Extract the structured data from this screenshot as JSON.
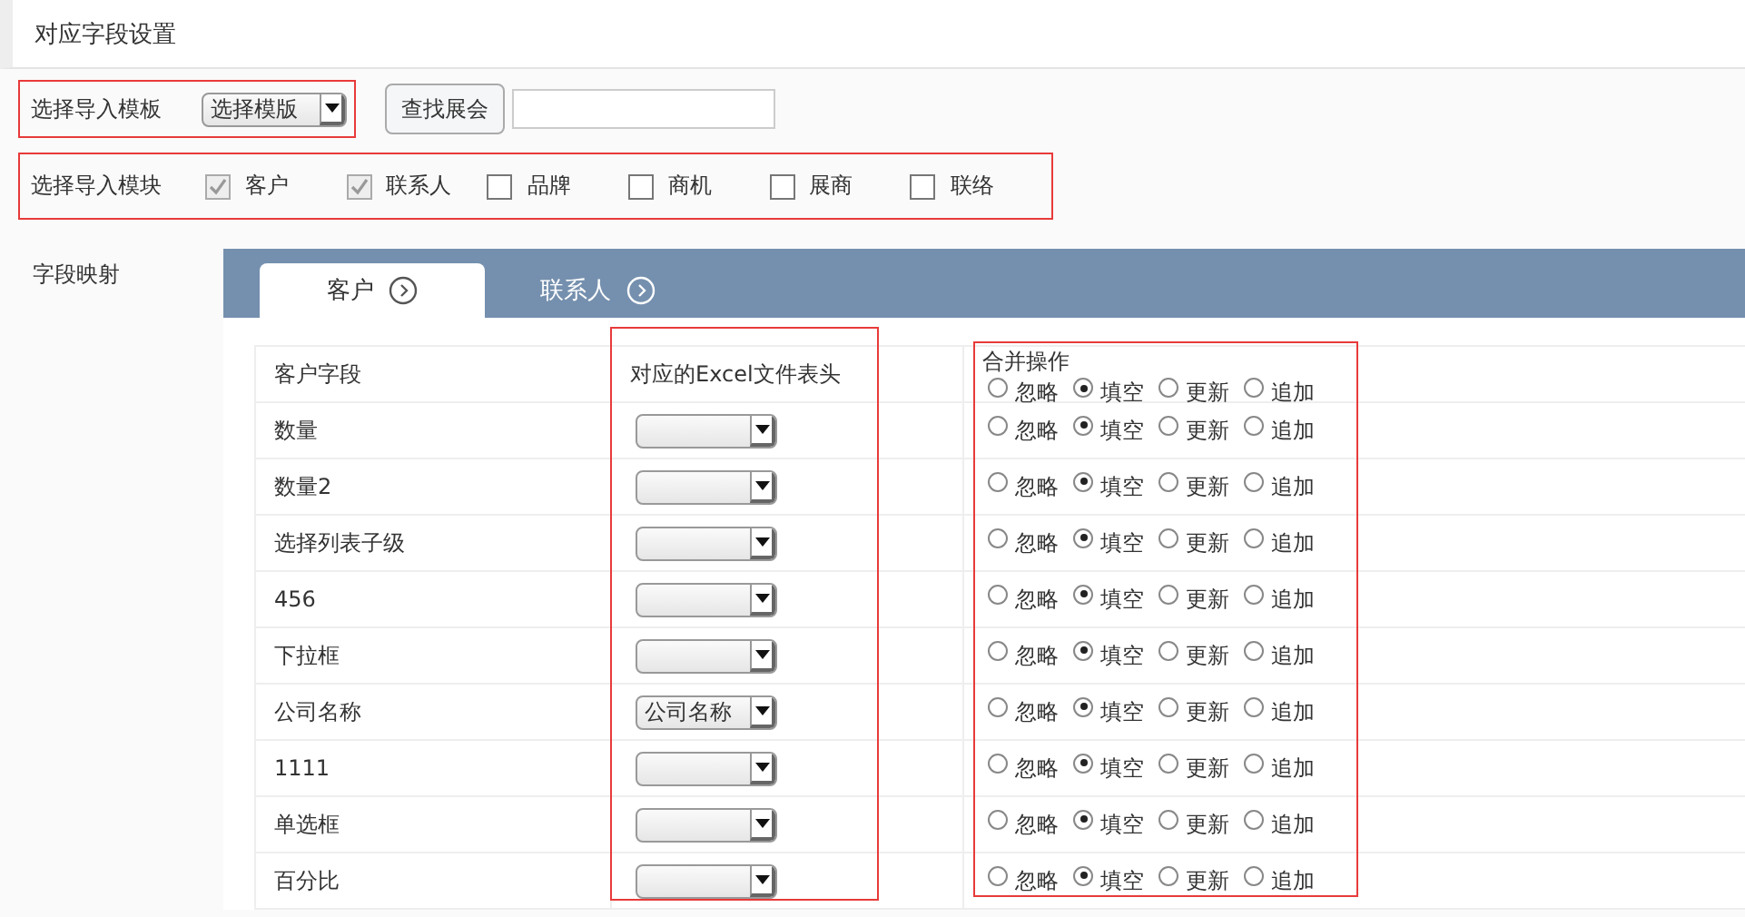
{
  "title": "对应字段设置",
  "template": {
    "label": "选择导入模板",
    "value": "选择模版"
  },
  "search_button": "查找展会",
  "modules": {
    "label": "选择导入模块",
    "items": [
      {
        "label": "客户",
        "checked": true
      },
      {
        "label": "联系人",
        "checked": true
      },
      {
        "label": "品牌",
        "checked": false
      },
      {
        "label": "商机",
        "checked": false
      },
      {
        "label": "展商",
        "checked": false
      },
      {
        "label": "联络",
        "checked": false
      }
    ]
  },
  "mapping_label": "字段映射",
  "tabs": [
    {
      "label": "客户",
      "selected": true
    },
    {
      "label": "联系人",
      "selected": false
    }
  ],
  "table": {
    "columns": [
      "客户字段",
      "对应的Excel文件表头",
      "合并操作"
    ],
    "header_options": [
      {
        "label": "忽略",
        "selected": false
      },
      {
        "label": "填空",
        "selected": true
      },
      {
        "label": "更新",
        "selected": false
      },
      {
        "label": "追加",
        "selected": false
      }
    ],
    "rows": [
      {
        "field": "数量",
        "excel": "",
        "options": [
          {
            "label": "忽略",
            "selected": false
          },
          {
            "label": "填空",
            "selected": true
          },
          {
            "label": "更新",
            "selected": false
          },
          {
            "label": "追加",
            "selected": false
          }
        ]
      },
      {
        "field": "数量2",
        "excel": "",
        "options": [
          {
            "label": "忽略",
            "selected": false
          },
          {
            "label": "填空",
            "selected": true
          },
          {
            "label": "更新",
            "selected": false
          },
          {
            "label": "追加",
            "selected": false
          }
        ]
      },
      {
        "field": "选择列表子级",
        "excel": "",
        "options": [
          {
            "label": "忽略",
            "selected": false
          },
          {
            "label": "填空",
            "selected": true
          },
          {
            "label": "更新",
            "selected": false
          },
          {
            "label": "追加",
            "selected": false
          }
        ]
      },
      {
        "field": "456",
        "excel": "",
        "options": [
          {
            "label": "忽略",
            "selected": false
          },
          {
            "label": "填空",
            "selected": true
          },
          {
            "label": "更新",
            "selected": false
          },
          {
            "label": "追加",
            "selected": false
          }
        ]
      },
      {
        "field": "下拉框",
        "excel": "",
        "options": [
          {
            "label": "忽略",
            "selected": false
          },
          {
            "label": "填空",
            "selected": true
          },
          {
            "label": "更新",
            "selected": false
          },
          {
            "label": "追加",
            "selected": false
          }
        ]
      },
      {
        "field": "公司名称",
        "excel": "公司名称",
        "options": [
          {
            "label": "忽略",
            "selected": false
          },
          {
            "label": "填空",
            "selected": true
          },
          {
            "label": "更新",
            "selected": false
          },
          {
            "label": "追加",
            "selected": false
          }
        ]
      },
      {
        "field": "1111",
        "excel": "",
        "options": [
          {
            "label": "忽略",
            "selected": false
          },
          {
            "label": "填空",
            "selected": true
          },
          {
            "label": "更新",
            "selected": false
          },
          {
            "label": "追加",
            "selected": false
          }
        ]
      },
      {
        "field": "单选框",
        "excel": "",
        "options": [
          {
            "label": "忽略",
            "selected": false
          },
          {
            "label": "填空",
            "selected": true
          },
          {
            "label": "更新",
            "selected": false
          },
          {
            "label": "追加",
            "selected": false
          }
        ]
      },
      {
        "field": "百分比",
        "excel": "",
        "options": [
          {
            "label": "忽略",
            "selected": false
          },
          {
            "label": "填空",
            "selected": true
          },
          {
            "label": "更新",
            "selected": false
          },
          {
            "label": "追加",
            "selected": false
          }
        ]
      }
    ]
  }
}
